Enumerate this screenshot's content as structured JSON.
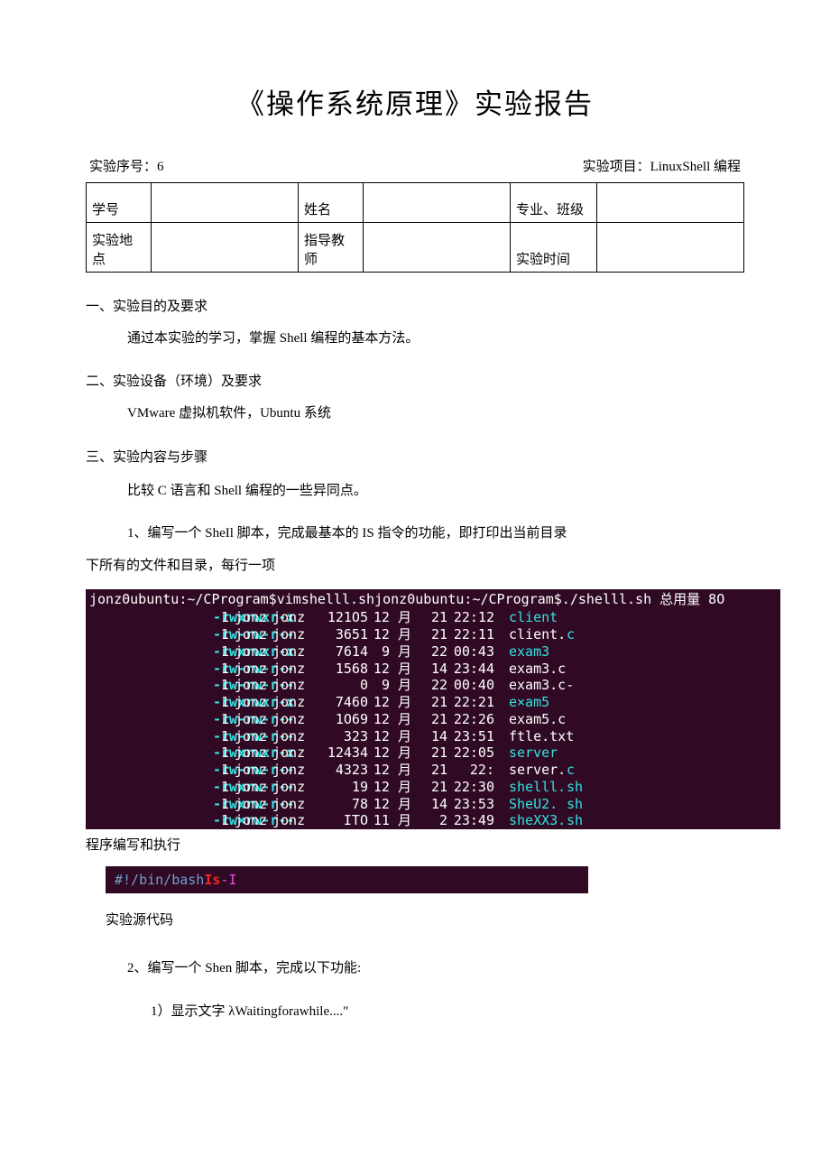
{
  "title": "《操作系统原理》实验报告",
  "meta": {
    "seq_label": "实验序号：6",
    "proj_label": "实验项目：LinuxShell 编程"
  },
  "form": {
    "r1c1": "学号",
    "r1c2": "",
    "r1c3": "姓名",
    "r1c4": "",
    "r1c5": "专业、班级",
    "r1c6": "",
    "r2c1": "实验地点",
    "r2c2": "",
    "r2c3": "指导教师",
    "r2c4": "",
    "r2c5": "实验时间",
    "r2c6": ""
  },
  "s1": {
    "h": "一、实验目的及要求",
    "p": "通过本实验的学习，掌握 Shell 编程的基本方法。"
  },
  "s2": {
    "h": "二、实验设备（环境）及要求",
    "p": "VMware 虚拟机软件，Ubuntu 系统"
  },
  "s3": {
    "h": "三、实验内容与步骤",
    "p1": "比较 C 语言和 Shell 编程的一些异同点。",
    "p2a": "1、编写一个 SheIl 脚本，完成最基本的 IS 指令的功能，即打印出当前目录",
    "p2b": "下所有的文件和目录，每行一项"
  },
  "term_header": "jonz0ubuntu:~/CProgram$vimshelll.shjonz0ubuntu:~/CProgram$./shelll.sh 总用量 8O",
  "rows": [
    {
      "perm": "-rwxrwxr-x",
      "lnk": "1",
      "own": "jonz",
      "grp": "jonz",
      "size": "121O5",
      "mon": "12 月",
      "day": "21",
      "time": "22:12",
      "name": "client",
      "ext": ""
    },
    {
      "perm": "-rw-rw-r--",
      "lnk": "1",
      "own": "jonz",
      "grp": "jonz",
      "size": "3651",
      "mon": "12 月",
      "day": "21",
      "time": "22:11",
      "name": "client.",
      "ext": "c",
      "namewhite": true
    },
    {
      "perm": "-rwxrwxr-x",
      "lnk": "1",
      "own": "jonz",
      "grp": "jonz",
      "size": "7614",
      "mon": "9 月",
      "day": "22",
      "time": "00:43",
      "name": "exam3",
      "ext": ""
    },
    {
      "perm": "-rw-rw-r--",
      "lnk": "1",
      "own": "jonz",
      "grp": "jonz",
      "size": "1568",
      "mon": "12 月",
      "day": "14",
      "time": "23:44",
      "name": "exam3.c",
      "ext": "",
      "namewhite": true
    },
    {
      "perm": "-rw-rw-r--",
      "lnk": "1",
      "own": "jonz",
      "grp": "jonz",
      "size": "0",
      "mon": "9 月",
      "day": "22",
      "time": "00:40",
      "name": "exam3.c-",
      "ext": "",
      "namewhite": true
    },
    {
      "perm": "-rwxrwxr-x",
      "lnk": "1",
      "own": "jonz",
      "grp": "jonz",
      "size": "7460",
      "mon": "12 月",
      "day": "21",
      "time": "22:21",
      "name": "e×am5",
      "ext": ""
    },
    {
      "perm": "-rw-rw-r--",
      "lnk": "1",
      "own": "jonz",
      "grp": "jonz",
      "size": "1O69",
      "mon": "12 月",
      "day": "21",
      "time": "22:26",
      "name": "exam5.c",
      "ext": "",
      "namewhite": true
    },
    {
      "perm": "-rw-rw-r--",
      "lnk": "1",
      "own": "jonz",
      "grp": "jonz",
      "size": "323",
      "mon": "12 月",
      "day": "14",
      "time": "23:51",
      "name": "ftle.txt",
      "ext": "",
      "namewhite": true
    },
    {
      "perm": "-rwxrwxr-x",
      "lnk": "1",
      "own": "jonz",
      "grp": "jonz",
      "size": "12434",
      "mon": "12 月",
      "day": "21",
      "time": "22:05",
      "name": "server",
      "ext": ""
    },
    {
      "perm": "-rw-rw-r--",
      "lnk": "1",
      "own": "jonz",
      "grp": "jonz",
      "size": "4323",
      "mon": "12 月",
      "day": "21",
      "time": "22:",
      "name": "server.",
      "ext": "c",
      "namewhite": true
    },
    {
      "perm": "-rwxrw-r--",
      "lnk": "1",
      "own": "jonz",
      "grp": "jonz",
      "size": "19",
      "mon": "12 月",
      "day": "21",
      "time": "22:30",
      "name": "shelll.",
      "ext": "sh"
    },
    {
      "perm": "-rwxrw-r--",
      "lnk": "1",
      "own": "jonz",
      "grp": "jonz",
      "size": "78",
      "mon": "12 月",
      "day": "14",
      "time": "23:53",
      "name": "SheU2.",
      "ext": "sh"
    },
    {
      "perm": "-rw×rw-r--",
      "lnk": "1",
      "own": "jonz",
      "grp": "jonz",
      "size": "ITO",
      "mon": "11 月",
      "day": "2",
      "time": "23:49",
      "name": "sheXX3.",
      "ext": "sh"
    }
  ],
  "cap1": "程序编写和执行",
  "code": {
    "comment": "#!/bin/bash",
    "cmd": "Is",
    "opt": "-I"
  },
  "cap2": "实验源代码",
  "q2": "2、编写一个 Shen 脚本，完成以下功能:",
  "q2a": "1）显示文字 λWaitingforawhile....\""
}
